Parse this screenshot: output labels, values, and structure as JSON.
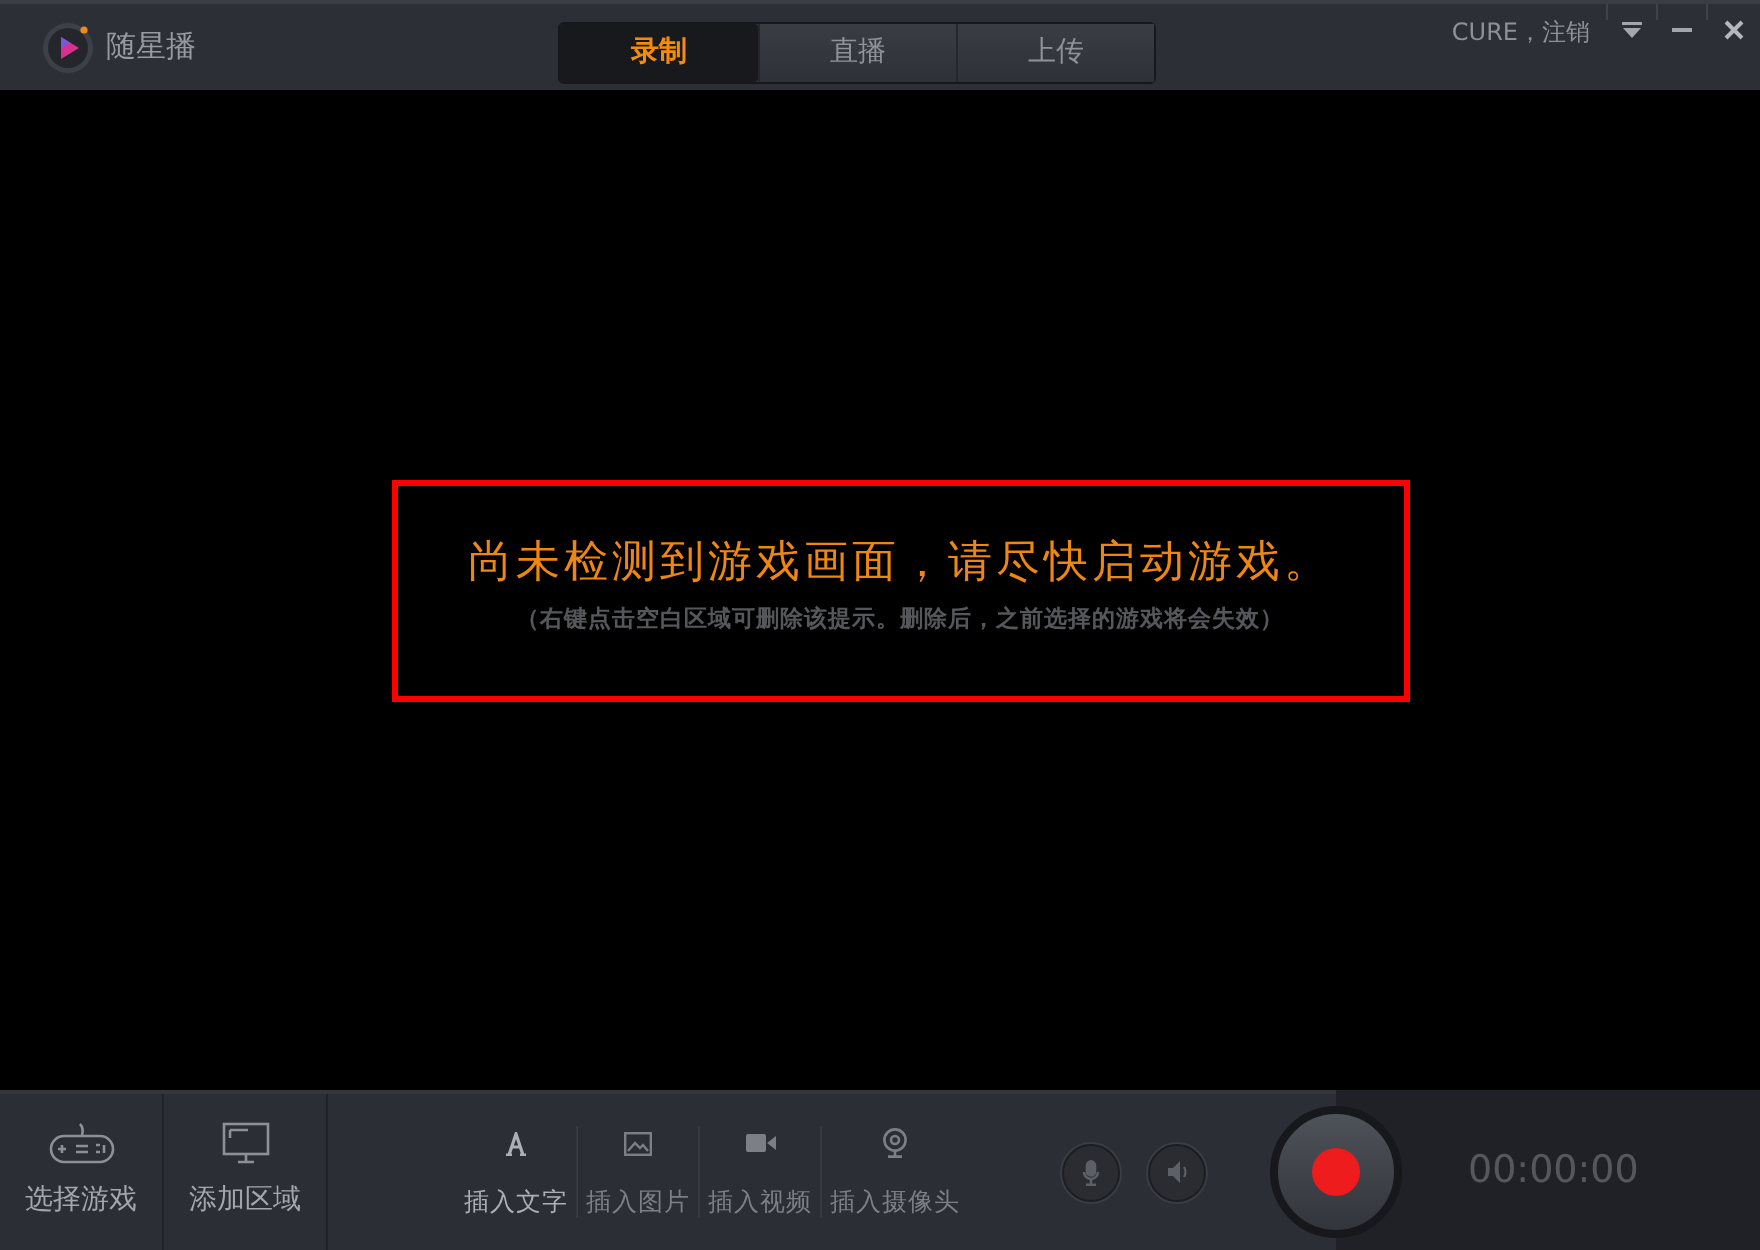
{
  "app": {
    "title": "随星播"
  },
  "tabs": [
    {
      "label": "录制",
      "selected": true
    },
    {
      "label": "直播",
      "selected": false
    },
    {
      "label": "上传",
      "selected": false
    }
  ],
  "account": {
    "text": "CURE，注销"
  },
  "notice": {
    "message": "尚未检测到游戏画面，请尽快启动游戏。",
    "hint": "（右键点击空白区域可删除该提示。删除后，之前选择的游戏将会失效）"
  },
  "toolbar": {
    "sources": [
      {
        "kind": "game",
        "label": "选择游戏"
      },
      {
        "kind": "region",
        "label": "添加区域"
      }
    ],
    "inserts": [
      {
        "kind": "text",
        "label": "插入文字",
        "disabled": false
      },
      {
        "kind": "image",
        "label": "插入图片",
        "disabled": true
      },
      {
        "kind": "video",
        "label": "插入视频",
        "disabled": true
      },
      {
        "kind": "camera",
        "label": "插入摄像头",
        "disabled": true
      }
    ]
  },
  "timer": {
    "text": "00:00:00"
  }
}
